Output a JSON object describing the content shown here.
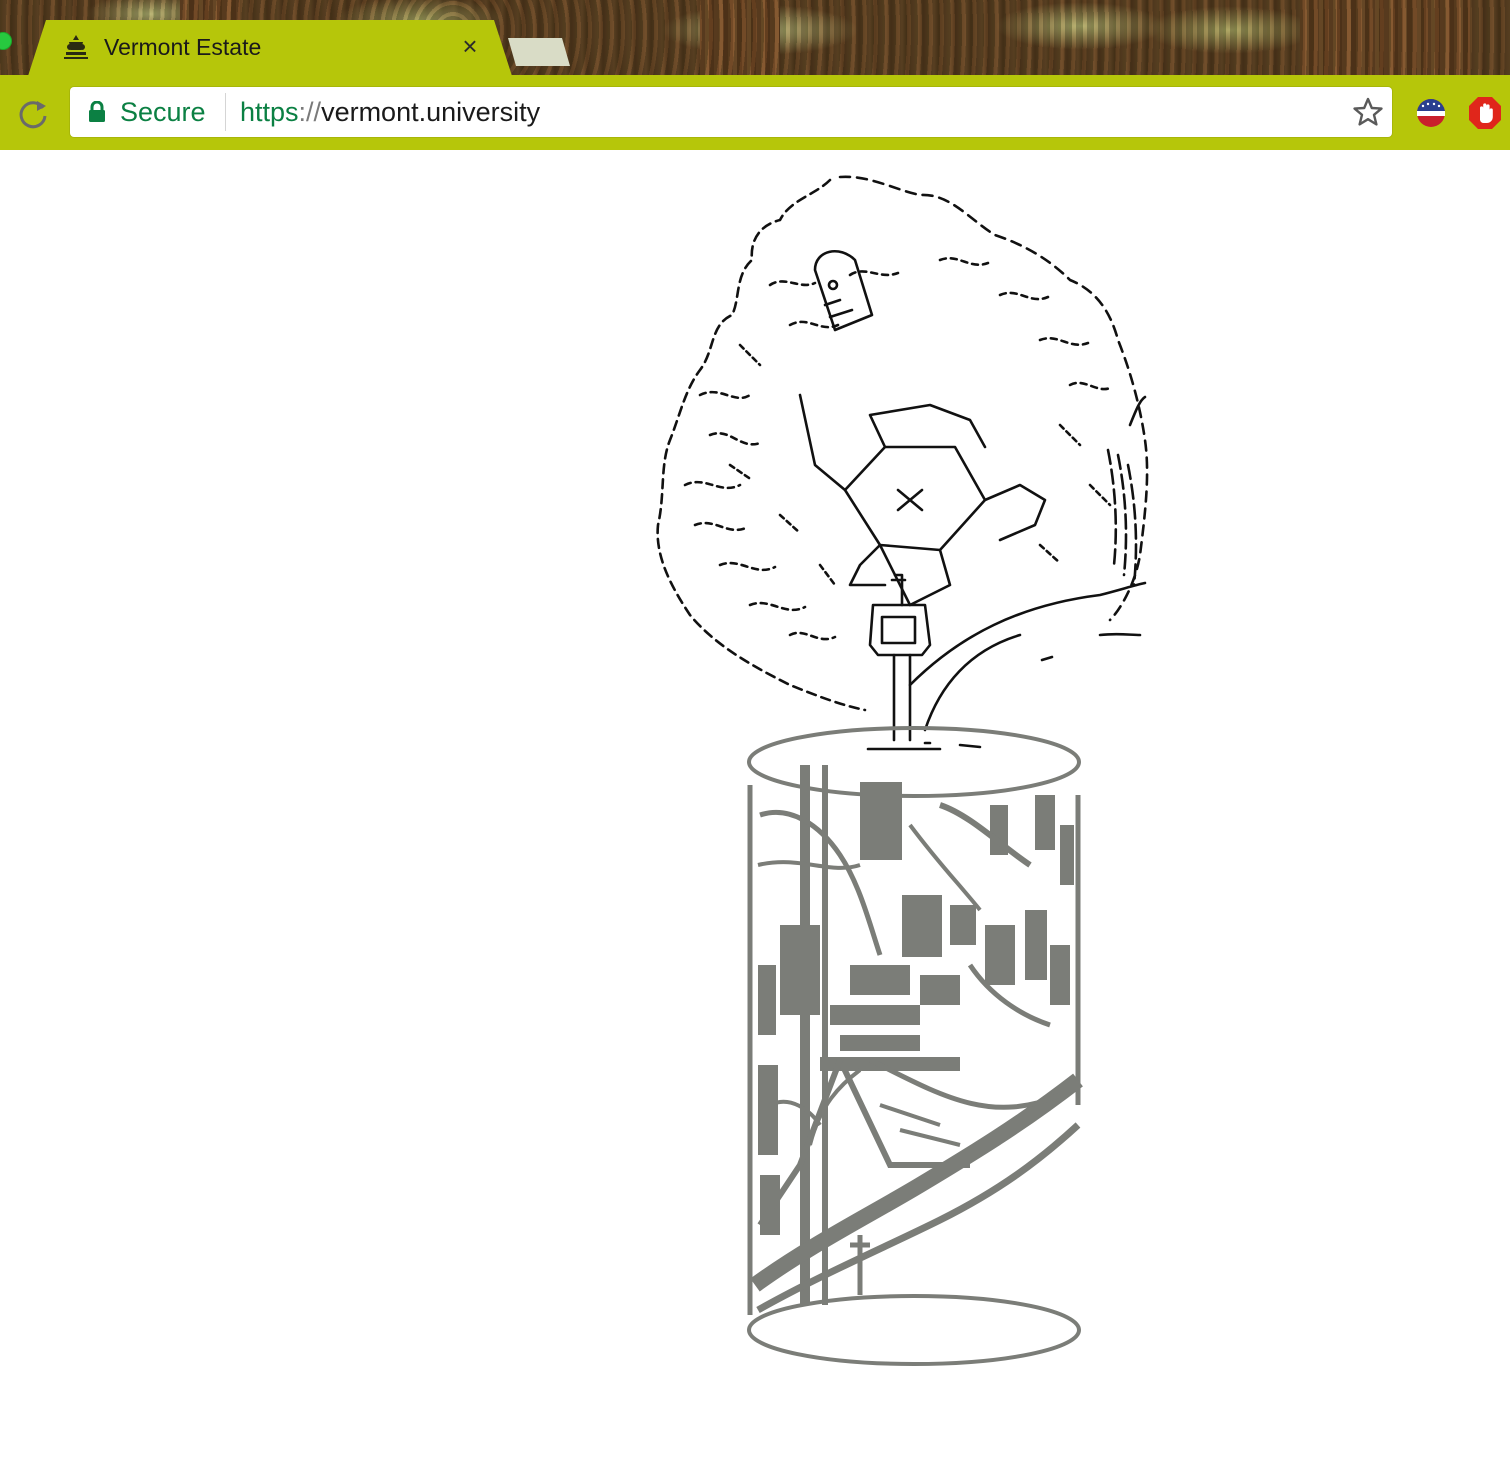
{
  "browser": {
    "tab": {
      "title": "Vermont Estate",
      "favicon": "vermont-seal-icon",
      "close_icon": "close-icon"
    },
    "new_tab_icon": "new-tab-icon",
    "toolbar": {
      "reload_icon": "reload-icon",
      "security_icon": "lock-icon",
      "security_label": "Secure",
      "url_scheme": "https",
      "url_separator": "://",
      "url_host": "vermont.university",
      "bookmark_icon": "star-icon",
      "extensions": [
        "election-badge-icon",
        "stop-hand-icon"
      ]
    },
    "colors": {
      "chrome_accent": "#b6c60a",
      "secure_green": "#0b8043",
      "drawing_black": "#111111",
      "drawing_gray": "#7b7d78"
    }
  },
  "page": {
    "content": "line-drawing-artwork"
  }
}
